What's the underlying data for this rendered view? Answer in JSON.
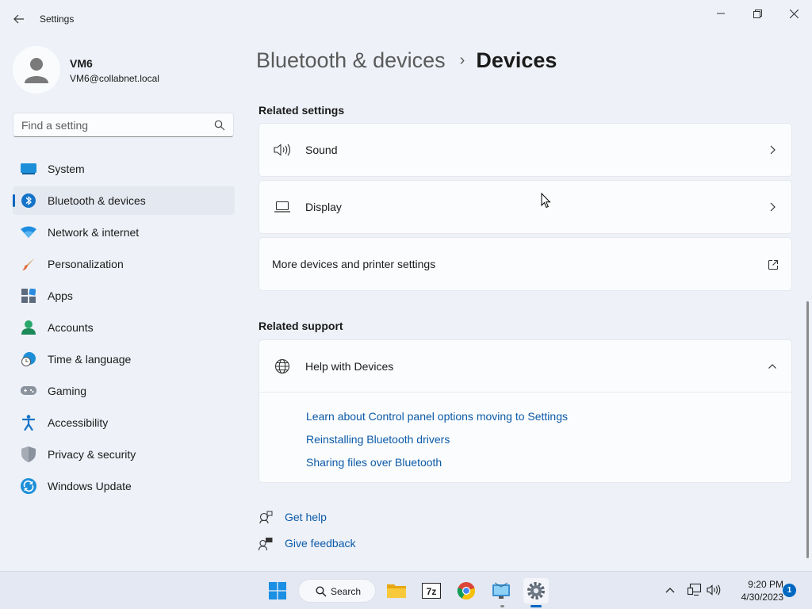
{
  "window": {
    "title": "Settings"
  },
  "user": {
    "name": "VM6",
    "email": "VM6@collabnet.local"
  },
  "search": {
    "placeholder": "Find a setting"
  },
  "sidebar": {
    "items": [
      {
        "label": "System",
        "icon": "system-icon"
      },
      {
        "label": "Bluetooth & devices",
        "icon": "bluetooth-icon",
        "active": true
      },
      {
        "label": "Network & internet",
        "icon": "wifi-icon"
      },
      {
        "label": "Personalization",
        "icon": "brush-icon"
      },
      {
        "label": "Apps",
        "icon": "apps-icon"
      },
      {
        "label": "Accounts",
        "icon": "accounts-icon"
      },
      {
        "label": "Time & language",
        "icon": "time-language-icon"
      },
      {
        "label": "Gaming",
        "icon": "gamepad-icon"
      },
      {
        "label": "Accessibility",
        "icon": "accessibility-icon"
      },
      {
        "label": "Privacy & security",
        "icon": "shield-icon"
      },
      {
        "label": "Windows Update",
        "icon": "windows-update-icon"
      }
    ]
  },
  "breadcrumb": {
    "parent": "Bluetooth & devices",
    "separator": "›",
    "current": "Devices"
  },
  "related_settings": {
    "title": "Related settings",
    "items": [
      {
        "label": "Sound",
        "icon": "speaker-icon",
        "action": "chevron-right-icon"
      },
      {
        "label": "Display",
        "icon": "laptop-icon",
        "action": "chevron-right-icon"
      },
      {
        "label": "More devices and printer settings",
        "action": "external-link-icon"
      }
    ]
  },
  "related_support": {
    "title": "Related support",
    "help": {
      "label": "Help with Devices",
      "icon": "globe-icon",
      "expanded": true,
      "links": [
        "Learn about Control panel options moving to Settings",
        "Reinstalling Bluetooth drivers",
        "Sharing files over Bluetooth"
      ]
    }
  },
  "footer_links": {
    "get_help": "Get help",
    "give_feedback": "Give feedback"
  },
  "taskbar": {
    "search_label": "Search",
    "clock_time": "9:20 PM",
    "clock_date": "4/30/2023",
    "notification_count": "1"
  },
  "colors": {
    "accent": "#0067c0",
    "link": "#0b5aa8",
    "background": "#eef1f8",
    "card": "#fbfcfd"
  }
}
